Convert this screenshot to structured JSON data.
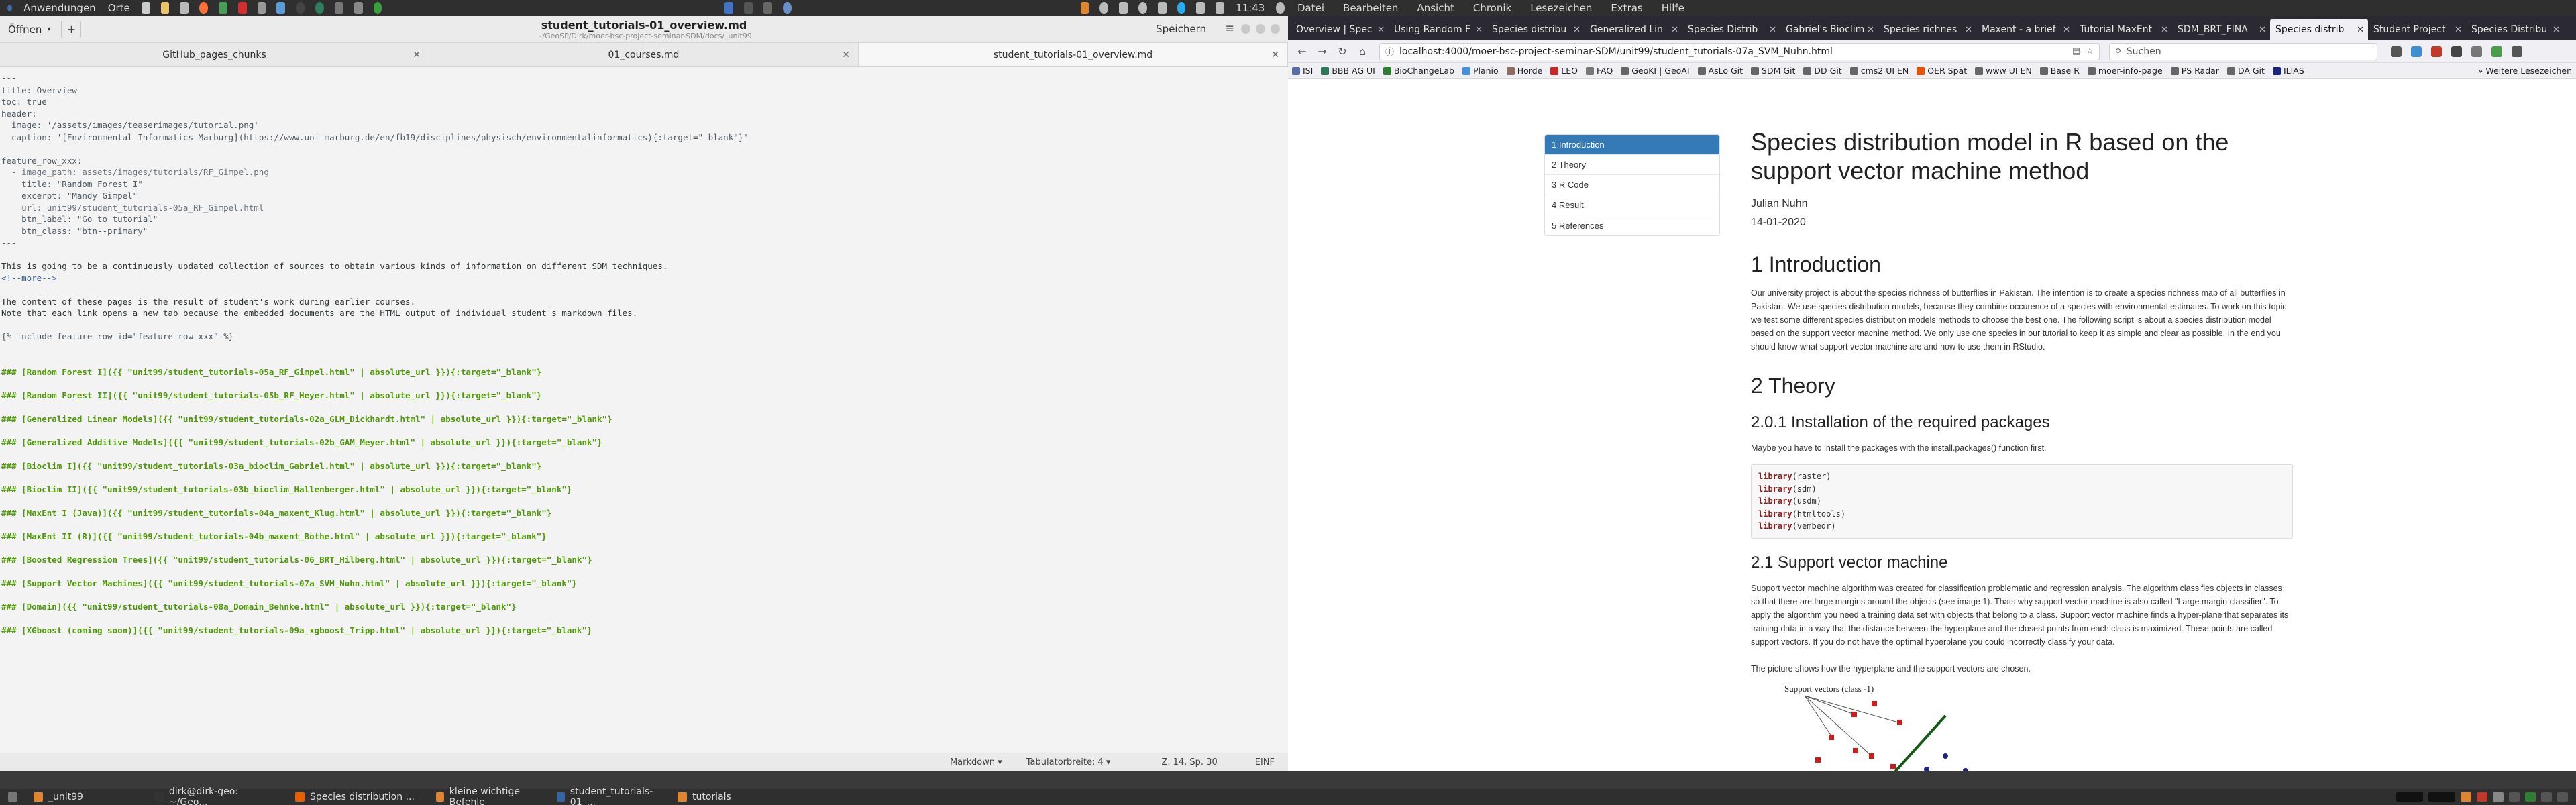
{
  "top_panel": {
    "apps_label": "Anwendungen",
    "places_label": "Orte",
    "clock": "11:43"
  },
  "browser_menu": [
    "Datei",
    "Bearbeiten",
    "Ansicht",
    "Chronik",
    "Lesezeichen",
    "Extras",
    "Hilfe"
  ],
  "editor": {
    "open_label": "Öffnen",
    "new_label": "+",
    "title": "student_tutorials-01_overview.md",
    "subtitle": "~/GeoSP/Dirk/moer-bsc-project-seminar-SDM/docs/_unit99",
    "save_label": "Speichern",
    "tabs": [
      {
        "label": "GitHub_pages_chunks"
      },
      {
        "label": "01_courses.md"
      },
      {
        "label": "student_tutorials-01_overview.md"
      }
    ],
    "lines": [
      {
        "t": "---",
        "c": "c-fm"
      },
      {
        "t": "title: Overview",
        "c": "c-fm"
      },
      {
        "t": "toc: true",
        "c": "c-fm"
      },
      {
        "t": "header:",
        "c": "c-fm"
      },
      {
        "t": "  image: '/assets/images/teaserimages/tutorial.png'",
        "c": "c-str"
      },
      {
        "t": "  caption: '[Environmental Informatics Marburg](https://www.uni-marburg.de/en/fb19/disciplines/physisch/environmentalinformatics){:target=\"_blank\"}'",
        "c": "c-str"
      },
      {
        "t": "",
        "c": ""
      },
      {
        "t": "feature_row_xxx:",
        "c": "c-fm"
      },
      {
        "t": "  - image_path: assets/images/tutorials/RF_Gimpel.png",
        "c": "c-it"
      },
      {
        "t": "    title: \"Random Forest I\"",
        "c": "c-str"
      },
      {
        "t": "    excerpt: \"Mandy Gimpel\"",
        "c": "c-str"
      },
      {
        "t": "    url: unit99/student_tutorials-05a_RF_Gimpel.html",
        "c": "c-it"
      },
      {
        "t": "    btn_label: \"Go to tutorial\"",
        "c": "c-str"
      },
      {
        "t": "    btn_class: \"btn--primary\"",
        "c": "c-str"
      },
      {
        "t": "---",
        "c": "c-fm"
      },
      {
        "t": "",
        "c": ""
      },
      {
        "t": "This is going to be a continuously updated collection of sources to obtain various kinds of information on different SDM techniques.",
        "c": ""
      },
      {
        "t": "<!--more-->",
        "c": "c-html"
      },
      {
        "t": "",
        "c": ""
      },
      {
        "t": "The content of these pages is the result of student's work during earlier courses.",
        "c": ""
      },
      {
        "t": "Note that each link opens a new tab because the embedded documents are the HTML output of individual student's markdown files.",
        "c": ""
      },
      {
        "t": "",
        "c": ""
      },
      {
        "t": "{% include feature_row id=\"feature_row_xxx\" %}",
        "c": "c-fm"
      },
      {
        "t": "",
        "c": ""
      },
      {
        "t": "",
        "c": ""
      },
      {
        "t": "### [Random Forest I]({{ \"unit99/student_tutorials-05a_RF_Gimpel.html\" | absolute_url }}){:target=\"_blank\"}",
        "c": "c-h"
      },
      {
        "t": "",
        "c": ""
      },
      {
        "t": "### [Random Forest II]({{ \"unit99/student_tutorials-05b_RF_Heyer.html\" | absolute_url }}){:target=\"_blank\"}",
        "c": "c-h"
      },
      {
        "t": "",
        "c": ""
      },
      {
        "t": "### [Generalized Linear Models]({{ \"unit99/student_tutorials-02a_GLM_Dickhardt.html\" | absolute_url }}){:target=\"_blank\"}",
        "c": "c-h"
      },
      {
        "t": "",
        "c": ""
      },
      {
        "t": "### [Generalized Additive Models]({{ \"unit99/student_tutorials-02b_GAM_Meyer.html\" | absolute_url }}){:target=\"_blank\"}",
        "c": "c-h"
      },
      {
        "t": "",
        "c": ""
      },
      {
        "t": "### [Bioclim I]({{ \"unit99/student_tutorials-03a_bioclim_Gabriel.html\" | absolute_url }}){:target=\"_blank\"}",
        "c": "c-h"
      },
      {
        "t": "",
        "c": ""
      },
      {
        "t": "### [Bioclim II]({{ \"unit99/student_tutorials-03b_bioclim_Hallenberger.html\" | absolute_url }}){:target=\"_blank\"}",
        "c": "c-h"
      },
      {
        "t": "",
        "c": ""
      },
      {
        "t": "### [MaxEnt I (Java)]({{ \"unit99/student_tutorials-04a_maxent_Klug.html\" | absolute_url }}){:target=\"_blank\"}",
        "c": "c-h"
      },
      {
        "t": "",
        "c": ""
      },
      {
        "t": "### [MaxEnt II (R)]({{ \"unit99/student_tutorials-04b_maxent_Bothe.html\" | absolute_url }}){:target=\"_blank\"}",
        "c": "c-h"
      },
      {
        "t": "",
        "c": ""
      },
      {
        "t": "### [Boosted Regression Trees]({{ \"unit99/student_tutorials-06_BRT_Hilberg.html\" | absolute_url }}){:target=\"_blank\"}",
        "c": "c-h"
      },
      {
        "t": "",
        "c": ""
      },
      {
        "t": "### [Support Vector Machines]({{ \"unit99/student_tutorials-07a_SVM_Nuhn.html\" | absolute_url }}){:target=\"_blank\"}",
        "c": "c-h"
      },
      {
        "t": "",
        "c": ""
      },
      {
        "t": "### [Domain]({{ \"unit99/student_tutorials-08a_Domain_Behnke.html\" | absolute_url }}){:target=\"_blank\"}",
        "c": "c-h"
      },
      {
        "t": "",
        "c": ""
      },
      {
        "t": "### [XGboost (coming soon)]({{ \"unit99/student_tutorials-09a_xgboost_Tripp.html\" | absolute_url }}){:target=\"_blank\"}",
        "c": "c-h"
      }
    ],
    "status": {
      "language": "Markdown ▾",
      "tab_width": "Tabulatorbreite: 4 ▾",
      "position": "Z. 14, Sp. 30",
      "mode": "EINF"
    }
  },
  "browser": {
    "tabs": [
      {
        "label": "Overview | Spec"
      },
      {
        "label": "Using Random F"
      },
      {
        "label": "Species distribu"
      },
      {
        "label": "Generalized Lin"
      },
      {
        "label": "Species Distrib"
      },
      {
        "label": "Gabriel's Bioclim"
      },
      {
        "label": "Species richnes"
      },
      {
        "label": "Maxent - a brief"
      },
      {
        "label": "Tutorial MaxEnt"
      },
      {
        "label": "SDM_BRT_FINA"
      },
      {
        "label": "Species distrib"
      },
      {
        "label": "Student Project"
      },
      {
        "label": "Species Distribu"
      }
    ],
    "active_tab_index": 10,
    "url": "localhost:4000/moer-bsc-project-seminar-SDM/unit99/student_tutorials-07a_SVM_Nuhn.html",
    "search_placeholder": "Suchen",
    "bookmarks": [
      {
        "label": "ISI",
        "color": "#5a6fa8"
      },
      {
        "label": "BBB AG UI",
        "color": "#2c7a5a"
      },
      {
        "label": "BioChangeLab",
        "color": "#2e7d32"
      },
      {
        "label": "Planio",
        "color": "#4a90d9"
      },
      {
        "label": "Horde",
        "color": "#8d6e63"
      },
      {
        "label": "LEO",
        "color": "#c62828"
      },
      {
        "label": "FAQ",
        "color": "#777777"
      },
      {
        "label": "GeoKI | GeoAI",
        "color": "#666666"
      },
      {
        "label": "AsLo Git",
        "color": "#666666"
      },
      {
        "label": "SDM Git",
        "color": "#666666"
      },
      {
        "label": "DD Git",
        "color": "#666666"
      },
      {
        "label": "cms2 UI EN",
        "color": "#666666"
      },
      {
        "label": "OER Spät",
        "color": "#e65100"
      },
      {
        "label": "www UI EN",
        "color": "#666666"
      },
      {
        "label": "Base R",
        "color": "#666666"
      },
      {
        "label": "moer-info-page",
        "color": "#666666"
      },
      {
        "label": "PS Radar",
        "color": "#666666"
      },
      {
        "label": "DA Git",
        "color": "#666666"
      },
      {
        "label": "ILIAS",
        "color": "#1a237e"
      }
    ],
    "more_bookmarks": "Weitere Lesezeichen",
    "page": {
      "toc": [
        "1 Introduction",
        "2 Theory",
        "3 R Code",
        "4 Result",
        "5 References"
      ],
      "title": "Species distribution model in R based on the support vector machine method",
      "author": "Julian Nuhn",
      "date": "14-01-2020",
      "h_intro": "1 Introduction",
      "p_intro": "Our university project is about the species richness of butterflies in Pakistan. The intention is to create a species richness map of all butterflies in Pakistan. We use species distribution models, because they combine occurence of a species with environmental estimates. To work on this topic we test some different species distribution models methods to choose the best one. The following script is about a species distribution model based on the support vector machine method. We only use one species in our tutorial to keep it as simple and clear as possible. In the end you should know what support vector machine are and how to use them in RStudio.",
      "h_theory": "2 Theory",
      "h_install": "2.0.1 Installation of the required packages",
      "p_install": "Maybe you have to install the packages with the install.packages() function first.",
      "code": [
        {
          "kw": "library",
          "arg": "(raster)"
        },
        {
          "kw": "library",
          "arg": "(sdm)"
        },
        {
          "kw": "library",
          "arg": "(usdm)"
        },
        {
          "kw": "library",
          "arg": "(htmltools)"
        },
        {
          "kw": "library",
          "arg": "(vembedr)"
        }
      ],
      "h_svm": "2.1 Support vector machine",
      "p_svm": "Support vector machine algorithm was created for classification problematic and regression analysis. The algorithm classifies objects in classes so that there are large margins around the objects (see image 1). Thats why support vector machine is also called \"Large margin classifier\". To apply the algorithm you need a training data set with objects that belong to a class. Support vector machine finds a hyper-plane that separates its training data in a way that the distance between the hyperplane and the closest points from each class is maximized. These points are called support vectors. If you do not have the optimal hyperplane you could incorrectly classify your data.",
      "p_picture": "The picture shows how the hyperplane and the support vectors are chosen.",
      "figure_label": "Support vectors (class -1)"
    }
  },
  "taskbar": [
    {
      "label": "_unit99",
      "color": "#e0852f"
    },
    {
      "label": "dirk@dirk-geo: ~/Geo...",
      "color": "#333333"
    },
    {
      "label": "Species distribution ...",
      "color": "#e66000"
    },
    {
      "label": "kleine wichtige Befehle",
      "color": "#e0852f"
    },
    {
      "label": "student_tutorials-01_...",
      "color": "#3465a4"
    },
    {
      "label": "tutorials",
      "color": "#e0852f"
    }
  ]
}
